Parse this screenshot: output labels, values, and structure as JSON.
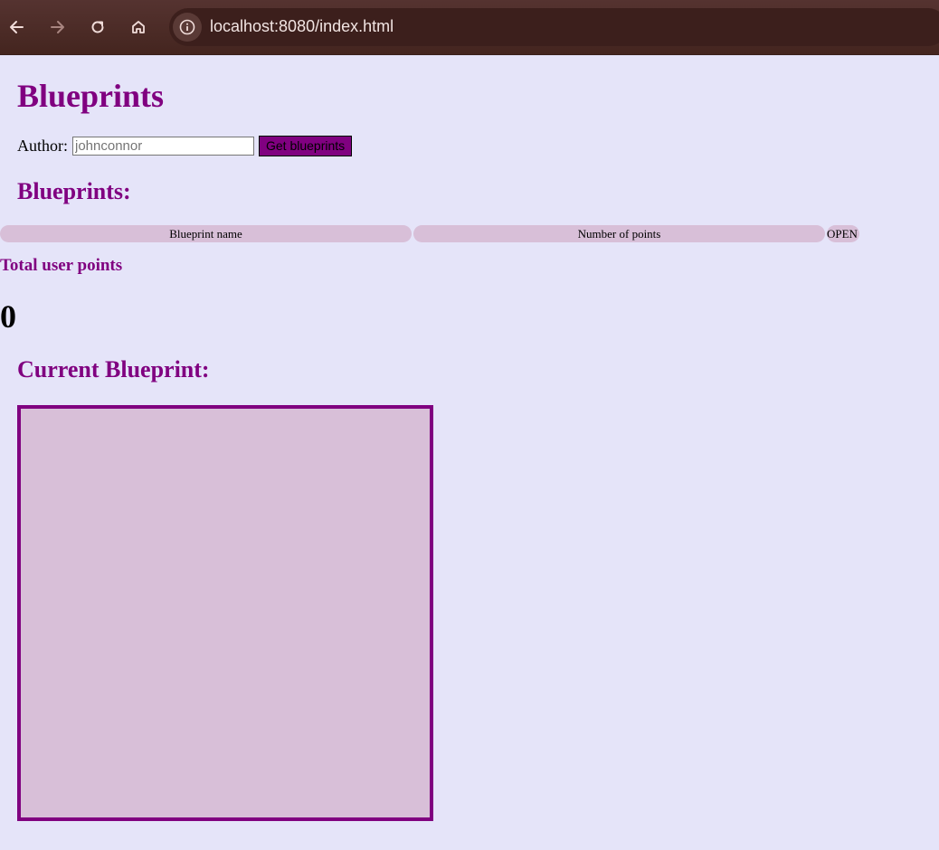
{
  "browser": {
    "url": "localhost:8080/index.html",
    "icons": {
      "back": "arrow-left-icon",
      "forward": "arrow-right-icon",
      "reload": "reload-icon",
      "home": "home-icon",
      "site_info": "info-icon"
    }
  },
  "page": {
    "title": "Blueprints",
    "author": {
      "label": "Author:",
      "placeholder": "johnconnor",
      "value": ""
    },
    "get_button_label": "Get blueprints",
    "list_title": "Blueprints:",
    "table": {
      "headers": [
        "Blueprint name",
        "Number of points",
        "OPEN"
      ],
      "rows": []
    },
    "total_label": "Total user points",
    "total_value": "0",
    "current_title": "Current Blueprint:"
  },
  "colors": {
    "accent": "#800080",
    "background": "#e5e4f9",
    "panel": "#d8bfd8",
    "chrome": "#4a2a26"
  }
}
